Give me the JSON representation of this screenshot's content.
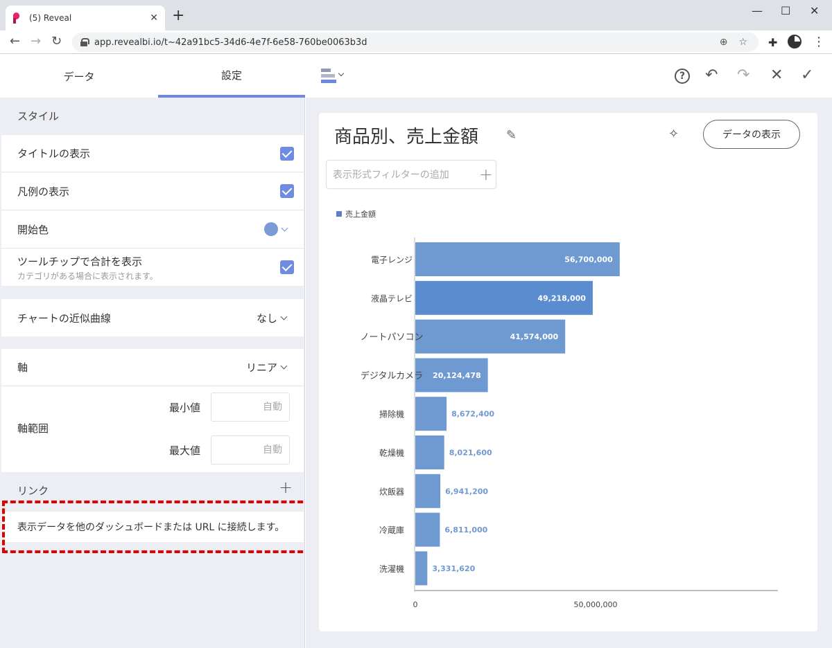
{
  "browser": {
    "tab_title": "(5) Reveal",
    "url": "app.revealbi.io/t~42a91bc5-34d6-4e7f-6e58-760be0063b3d"
  },
  "left_panel": {
    "tabs": [
      "データ",
      "設定"
    ],
    "style_header": "スタイル",
    "show_title_label": "タイトルの表示",
    "show_legend_label": "凡例の表示",
    "start_color_label": "開始色",
    "tooltip_total_label": "ツールチップで合計を表示",
    "tooltip_total_sub": "カテゴリがある場合に表示されます。",
    "trendline_label": "チャートの近似曲線",
    "trendline_value": "なし",
    "axis_label": "軸",
    "axis_value": "リニア",
    "axis_range_label": "軸範囲",
    "min_label": "最小値",
    "max_label": "最大値",
    "min_value": "自動",
    "max_value": "自動",
    "link_header": "リンク",
    "link_desc": "表示データを他のダッシュボードまたは URL に接続します。"
  },
  "viz": {
    "title": "商品別、売上金額",
    "show_data_button": "データの表示",
    "filter_placeholder": "表示形式フィルターの追加"
  },
  "colors": {
    "accent": "#6d88e4",
    "bar": "#6f99d1",
    "bar_highlight": "#5b8cd0"
  },
  "chart_data": {
    "type": "bar",
    "orientation": "horizontal",
    "legend": "売上金額",
    "categories": [
      "電子レンジ",
      "液晶テレビ",
      "ノートパソコン",
      "デジタルカメラ",
      "掃除機",
      "乾燥機",
      "炊飯器",
      "冷蔵庫",
      "洗濯機"
    ],
    "values": [
      56700000,
      49218000,
      41574000,
      20124478,
      8672400,
      8021600,
      6941200,
      6811000,
      3331620
    ],
    "value_labels": [
      "56,700,000",
      "49,218,000",
      "41,574,000",
      "20,124,478",
      "8,672,400",
      "8,021,600",
      "6,941,200",
      "6,811,000",
      "3,331,620"
    ],
    "x_ticks": [
      "0",
      "50,000,000"
    ],
    "xlim": [
      0,
      100000000
    ]
  }
}
